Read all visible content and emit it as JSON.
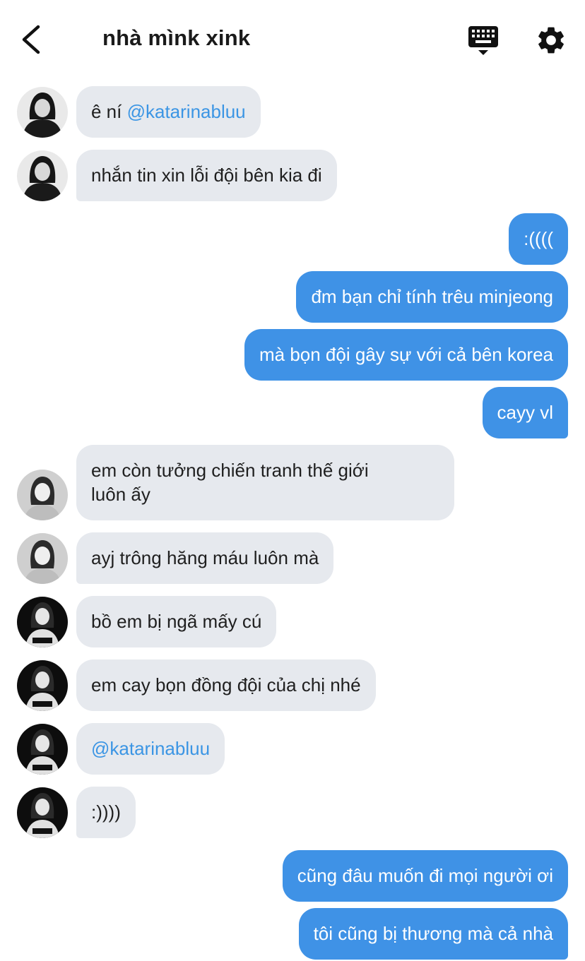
{
  "header": {
    "title": "nhà mìnk xink"
  },
  "icons": {
    "back": "chevron-left-icon",
    "keyboard": "keyboard-icon",
    "settings": "gear-icon"
  },
  "colors": {
    "outgoing_bubble": "#3f92e6",
    "incoming_bubble": "#e6e9ee",
    "mention": "#3b95e4"
  },
  "messages": [
    {
      "side": "in",
      "text": "ê ní ",
      "mention": "@katarinabluu"
    },
    {
      "side": "in",
      "text": "nhắn tin xin lỗi đội bên kia đi"
    },
    {
      "side": "out",
      "text": ":(((("
    },
    {
      "side": "out",
      "text": "đm bạn chỉ tính trêu minjeong"
    },
    {
      "side": "out",
      "text": "mà bọn đội gây sự với cả bên korea"
    },
    {
      "side": "out",
      "text": "cayy vl"
    },
    {
      "side": "in",
      "line1": "em còn tưởng chiến tranh thế giới",
      "line2": "luôn ấy"
    },
    {
      "side": "in",
      "text": "ayj trông hăng máu luôn mà"
    },
    {
      "side": "in",
      "text": "bồ em bị ngã mấy cú"
    },
    {
      "side": "in",
      "text": "em cay bọn đồng đội của chị nhé"
    },
    {
      "side": "in",
      "mention": "@katarinabluu"
    },
    {
      "side": "in",
      "text": ":))))"
    },
    {
      "side": "out",
      "text": "cũng đâu muốn đi mọi người ơi"
    },
    {
      "side": "out",
      "text": "tôi cũng bị thương mà cả nhà"
    }
  ]
}
